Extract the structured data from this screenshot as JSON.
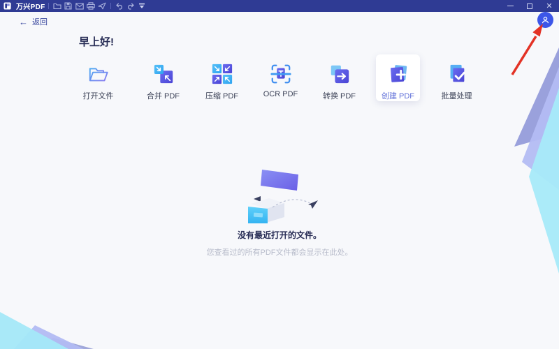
{
  "app": {
    "title": "万兴PDF"
  },
  "titlebar": {
    "icon_names": [
      "app-logo",
      "folder-open",
      "save",
      "email",
      "print",
      "share",
      "undo",
      "redo",
      "toolbar-toggle"
    ],
    "window_controls": [
      "minimize",
      "maximize",
      "close"
    ],
    "close_glyph": "✕"
  },
  "nav": {
    "back_arrow": "←",
    "back_label": "返回"
  },
  "greeting": "早上好!",
  "actions": [
    {
      "id": "open-file",
      "label": "打开文件"
    },
    {
      "id": "merge-pdf",
      "label": "合并 PDF"
    },
    {
      "id": "compress-pdf",
      "label": "压缩 PDF"
    },
    {
      "id": "ocr-pdf",
      "label": "OCR PDF"
    },
    {
      "id": "convert-pdf",
      "label": "转换 PDF"
    },
    {
      "id": "create-pdf",
      "label": "创建 PDF",
      "selected": true
    },
    {
      "id": "batch-process",
      "label": "批量处理"
    }
  ],
  "empty_state": {
    "title": "没有最近打开的文件。",
    "subtitle": "您查看过的所有PDF文件都会显示在此处。"
  },
  "colors": {
    "titlebar": "#2f3b94",
    "background": "#f7f8fb",
    "accent_blue": "#3fa9f5",
    "accent_indigo": "#5558e0",
    "selected_label": "#5f6fd8",
    "avatar": "#3c56e8",
    "annotation_arrow": "#e33225"
  }
}
